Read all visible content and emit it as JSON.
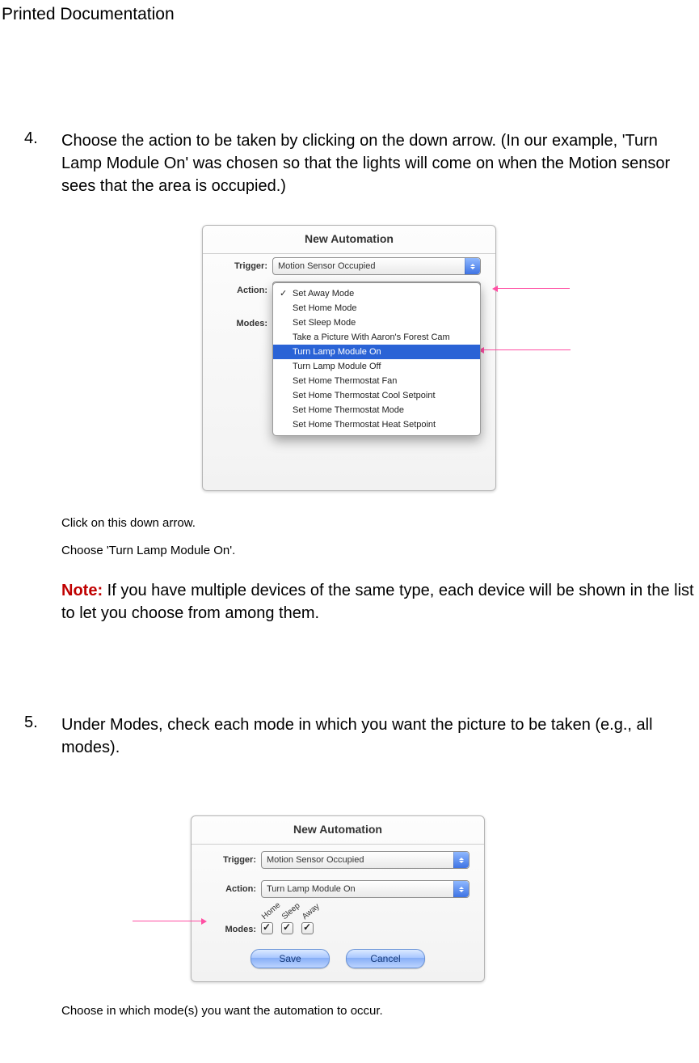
{
  "header": {
    "title": "Printed Documentation"
  },
  "steps": {
    "four": {
      "num": "4.",
      "text": "Choose the action to be taken by clicking on the down arrow. (In our example, 'Turn Lamp Module On' was chosen so that the lights will come on when the Motion sensor sees that the area is occupied.)"
    },
    "five": {
      "num": "5.",
      "text": "Under Modes, check each mode in which you want the picture to be taken (e.g., all modes)."
    }
  },
  "fig1": {
    "panel_title": "New Automation",
    "trigger_label": "Trigger:",
    "trigger_value": "Motion Sensor Occupied",
    "action_label": "Action:",
    "modes_label": "Modes:",
    "dropdown": {
      "items": [
        "Set Away Mode",
        "Set Home Mode",
        "Set Sleep Mode",
        "Take a Picture With Aaron's Forest Cam",
        "Turn Lamp Module On",
        "Turn Lamp Module Off",
        "Set Home Thermostat Fan",
        "Set Home Thermostat Cool Setpoint",
        "Set Home Thermostat Mode",
        "Set Home Thermostat Heat Setpoint"
      ],
      "checked_index": 0,
      "selected_index": 4
    },
    "captions": {
      "c1": "Click on this down arrow.",
      "c2": "Choose 'Turn Lamp Module On'."
    }
  },
  "note": {
    "label": "Note:",
    "text": " If you have multiple devices of the same type, each device will be shown in the list to let you choose from among them."
  },
  "fig2": {
    "panel_title": "New Automation",
    "trigger_label": "Trigger:",
    "trigger_value": "Motion Sensor Occupied",
    "action_label": "Action:",
    "action_value": "Turn Lamp Module On",
    "modes_label": "Modes:",
    "modes": [
      {
        "label": "Home",
        "checked": true
      },
      {
        "label": "Sleep",
        "checked": true
      },
      {
        "label": "Away",
        "checked": true
      }
    ],
    "save_label": "Save",
    "cancel_label": "Cancel",
    "caption": "Choose in which mode(s) you want the automation to occur."
  }
}
